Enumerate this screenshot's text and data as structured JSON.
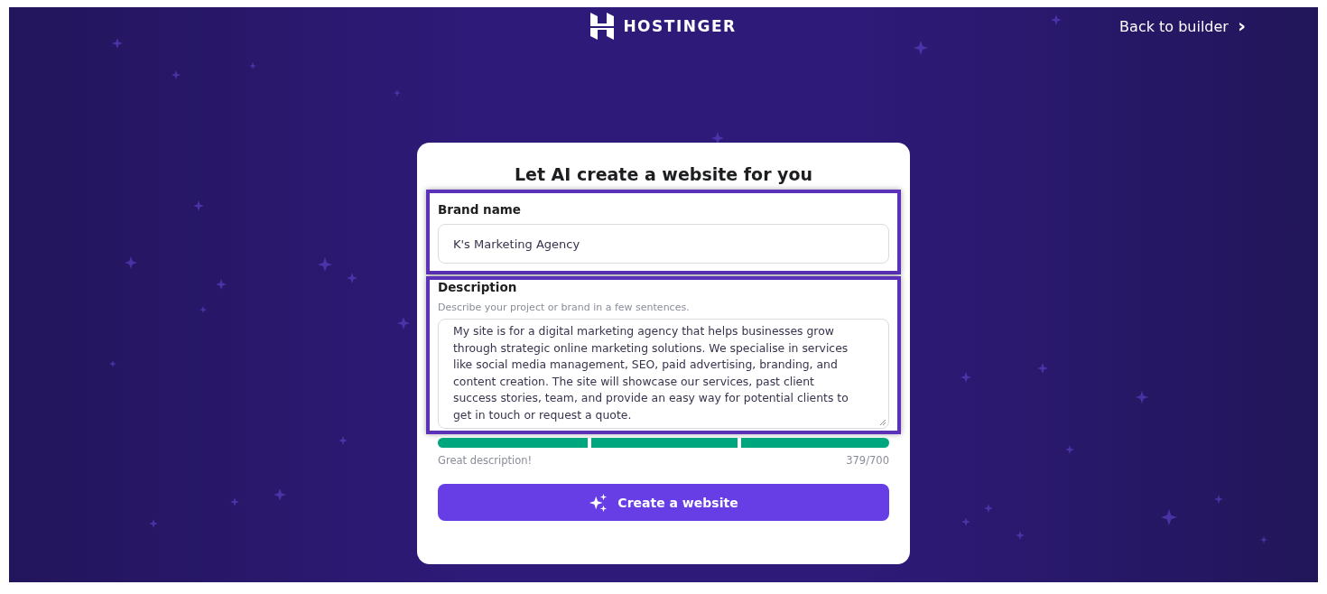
{
  "header": {
    "logo_text": "HOSTINGER",
    "back_link": "Back to builder",
    "back_icon": "›"
  },
  "card": {
    "title": "Let AI create a website for you",
    "brand": {
      "label": "Brand name",
      "value": "K's Marketing Agency",
      "highlighted": true
    },
    "description": {
      "label": "Description",
      "hint": "Describe your project or brand in a few sentences.",
      "value": "My site is for a digital marketing agency that helps businesses grow through strategic online marketing solutions. We specialise in services like social media management, SEO, paid advertising, branding, and content creation. The site will showcase our services, past client success stories, team, and provide an easy way for potential clients to get in touch or request a quote.",
      "highlighted": true
    },
    "strength": {
      "level": 1,
      "feedback": "Great description!",
      "count": "379/700"
    },
    "button": "Create a website"
  }
}
